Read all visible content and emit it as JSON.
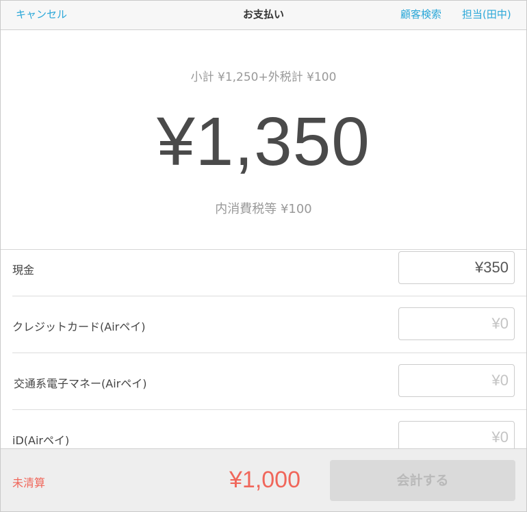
{
  "header": {
    "cancel_label": "キャンセル",
    "title": "お支払い",
    "customer_search_label": "顧客検索",
    "staff_label": "担当(田中)"
  },
  "summary": {
    "subtotal_text": "小計 ¥1,250+外税計 ¥100",
    "total": "¥1,350",
    "tax_included_text": "内消費税等 ¥100"
  },
  "payments": [
    {
      "label": "現金",
      "value": "¥350",
      "placeholder": "¥0"
    },
    {
      "label": "クレジットカード(Airペイ)",
      "value": "",
      "placeholder": "¥0"
    },
    {
      "label": "交通系電子マネー(Airペイ)",
      "value": "",
      "placeholder": "¥0"
    },
    {
      "label": "iD(Airペイ)",
      "value": "",
      "placeholder": "¥0"
    }
  ],
  "footer": {
    "unsettled_label": "未清算",
    "unsettled_amount": "¥1,000",
    "checkout_label": "会計する"
  },
  "colors": {
    "accent": "#2aa7d8",
    "warning": "#f0665a",
    "disabled_button": "#dadada"
  }
}
